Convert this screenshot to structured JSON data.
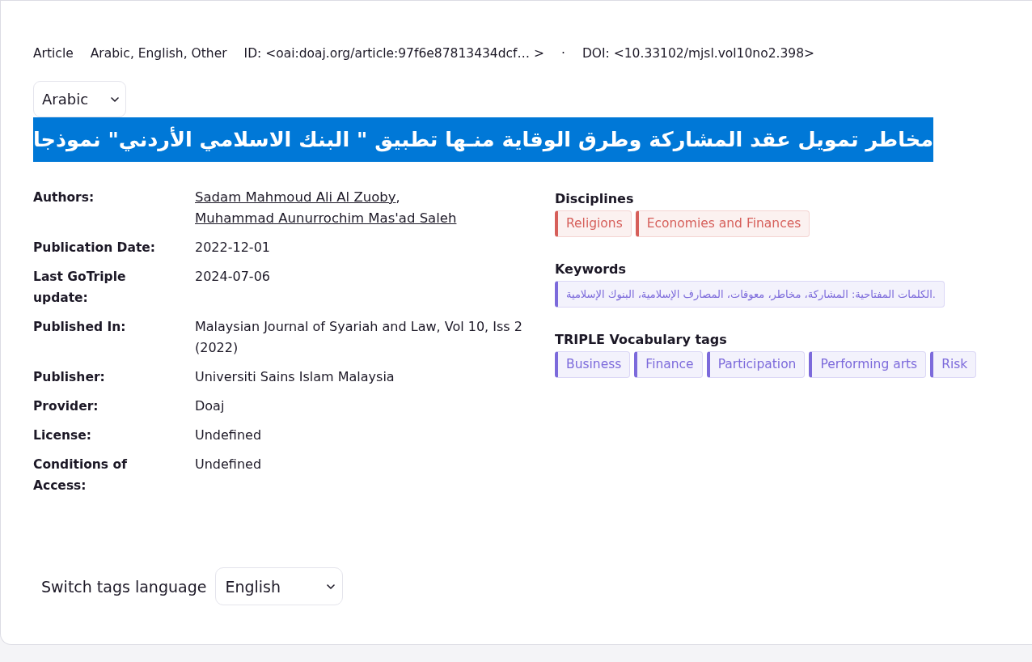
{
  "meta_line": [
    "Article",
    "Arabic, English, Other",
    "ID: <oai:doaj.org/article:97f6e87813434dcf… >",
    "·",
    "DOI: <10.33102/mjsl.vol10no2.398>"
  ],
  "title_language_select": {
    "value": "Arabic"
  },
  "title": {
    "text": "مخاطر تمويل عقد المشاركة وطرق الوقاية منـها تطبيق \" البنك الاسلامي الأردني\" نموذجا",
    "highlighted": true
  },
  "details": [
    {
      "kind": "authors",
      "label": "Authors:",
      "authors": [
        "Sadam Mahmoud Ali Al Zuoby",
        "Muhammad Aunurrochim Mas'ad Saleh"
      ],
      "separator": ","
    },
    {
      "kind": "text",
      "label": "Publication Date:",
      "value": "2022-12-01"
    },
    {
      "kind": "text",
      "label": "Last GoTriple update:",
      "value": "2024-07-06"
    },
    {
      "kind": "text",
      "label": "Published In:",
      "value": "Malaysian Journal of Syariah and Law, Vol 10, Iss 2 (2022)"
    },
    {
      "kind": "text",
      "label": "Publisher:",
      "value": "Universiti Sains Islam Malaysia"
    },
    {
      "kind": "text",
      "label": "Provider:",
      "value": "Doaj"
    },
    {
      "kind": "text",
      "label": "License:",
      "value": "Undefined"
    },
    {
      "kind": "text",
      "label": "Conditions of Access:",
      "value": "Undefined"
    }
  ],
  "sections": [
    {
      "heading": "Disciplines",
      "kind": "tags",
      "color": "#d65f5a",
      "tags": [
        "Religions",
        "Economies and Finances"
      ]
    },
    {
      "heading": "Keywords",
      "kind": "keywords",
      "color": "#7c6adb",
      "tags": [
        "الكلمات المفتاحية: المشاركة، مخاطر، معوقات، المصارف الإسلامية، البنوك الإسلامية."
      ]
    },
    {
      "heading": "TRIPLE Vocabulary tags",
      "kind": "tags",
      "color": "#7c6adb",
      "tags": [
        "Business",
        "Finance",
        "Participation",
        "Performing arts",
        "Risk"
      ]
    }
  ],
  "tags_language": {
    "label": "Switch tags language",
    "select": {
      "value": "English"
    }
  }
}
